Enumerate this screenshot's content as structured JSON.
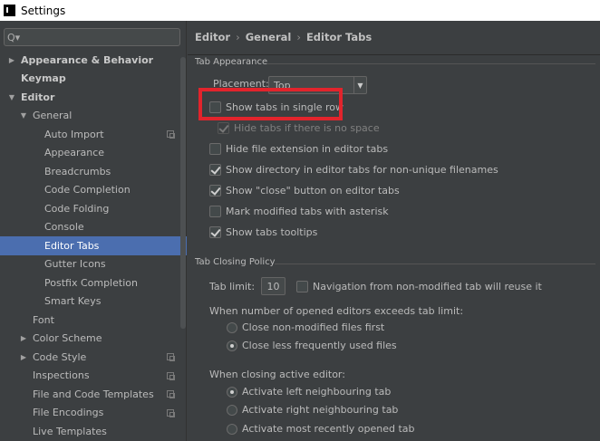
{
  "window": {
    "title": "Settings"
  },
  "sidebar": {
    "search_placeholder": "",
    "items": [
      {
        "label": "Appearance & Behavior",
        "bold": true,
        "arrow": "▶",
        "indent": 0
      },
      {
        "label": "Keymap",
        "bold": true,
        "arrow": "",
        "indent": 0
      },
      {
        "label": "Editor",
        "bold": true,
        "arrow": "▼",
        "indent": 0
      },
      {
        "label": "General",
        "bold": false,
        "arrow": "▼",
        "indent": 1
      },
      {
        "label": "Auto Import",
        "bold": false,
        "arrow": "",
        "indent": 2,
        "proj": true
      },
      {
        "label": "Appearance",
        "bold": false,
        "arrow": "",
        "indent": 2
      },
      {
        "label": "Breadcrumbs",
        "bold": false,
        "arrow": "",
        "indent": 2
      },
      {
        "label": "Code Completion",
        "bold": false,
        "arrow": "",
        "indent": 2
      },
      {
        "label": "Code Folding",
        "bold": false,
        "arrow": "",
        "indent": 2
      },
      {
        "label": "Console",
        "bold": false,
        "arrow": "",
        "indent": 2
      },
      {
        "label": "Editor Tabs",
        "bold": false,
        "arrow": "",
        "indent": 2,
        "selected": true
      },
      {
        "label": "Gutter Icons",
        "bold": false,
        "arrow": "",
        "indent": 2
      },
      {
        "label": "Postfix Completion",
        "bold": false,
        "arrow": "",
        "indent": 2
      },
      {
        "label": "Smart Keys",
        "bold": false,
        "arrow": "",
        "indent": 2
      },
      {
        "label": "Font",
        "bold": false,
        "arrow": "",
        "indent": 1
      },
      {
        "label": "Color Scheme",
        "bold": false,
        "arrow": "▶",
        "indent": 1
      },
      {
        "label": "Code Style",
        "bold": false,
        "arrow": "▶",
        "indent": 1,
        "proj": true
      },
      {
        "label": "Inspections",
        "bold": false,
        "arrow": "",
        "indent": 1,
        "proj": true
      },
      {
        "label": "File and Code Templates",
        "bold": false,
        "arrow": "",
        "indent": 1,
        "proj": true
      },
      {
        "label": "File Encodings",
        "bold": false,
        "arrow": "",
        "indent": 1,
        "proj": true
      },
      {
        "label": "Live Templates",
        "bold": false,
        "arrow": "",
        "indent": 1
      }
    ]
  },
  "breadcrumb": {
    "items": [
      "Editor",
      "General",
      "Editor Tabs"
    ],
    "separator": "›"
  },
  "tab_appearance": {
    "title": "Tab Appearance",
    "placement_label": "Placement:",
    "placement_value": "Top",
    "options": [
      {
        "label": "Show tabs in single row",
        "checked": false,
        "disabled": false
      },
      {
        "label": "Hide tabs if there is no space",
        "checked": true,
        "disabled": true
      },
      {
        "label": "Hide file extension in editor tabs",
        "checked": false,
        "disabled": false
      },
      {
        "label": "Show directory in editor tabs for non-unique filenames",
        "checked": true,
        "disabled": false
      },
      {
        "label": "Show \"close\" button on editor tabs",
        "checked": true,
        "disabled": false
      },
      {
        "label": "Mark modified tabs with asterisk",
        "checked": false,
        "disabled": false
      },
      {
        "label": "Show tabs tooltips",
        "checked": true,
        "disabled": false
      }
    ]
  },
  "tab_closing": {
    "title": "Tab Closing Policy",
    "tab_limit_label": "Tab limit:",
    "tab_limit_value": "10",
    "nav_label": "Navigation from non-modified tab will reuse it",
    "nav_checked": false,
    "exceeds_label": "When number of opened editors exceeds tab limit:",
    "exceeds_options": [
      {
        "label": "Close non-modified files first",
        "checked": false
      },
      {
        "label": "Close less frequently used files",
        "checked": true
      }
    ],
    "closing_label": "When closing active editor:",
    "closing_options": [
      {
        "label": "Activate left neighbouring tab",
        "checked": true
      },
      {
        "label": "Activate right neighbouring tab",
        "checked": false
      },
      {
        "label": "Activate most recently opened tab",
        "checked": false
      }
    ]
  },
  "colors": {
    "highlight": "#e2242c",
    "selection": "#4b6eaf",
    "background": "#3c3f41"
  }
}
